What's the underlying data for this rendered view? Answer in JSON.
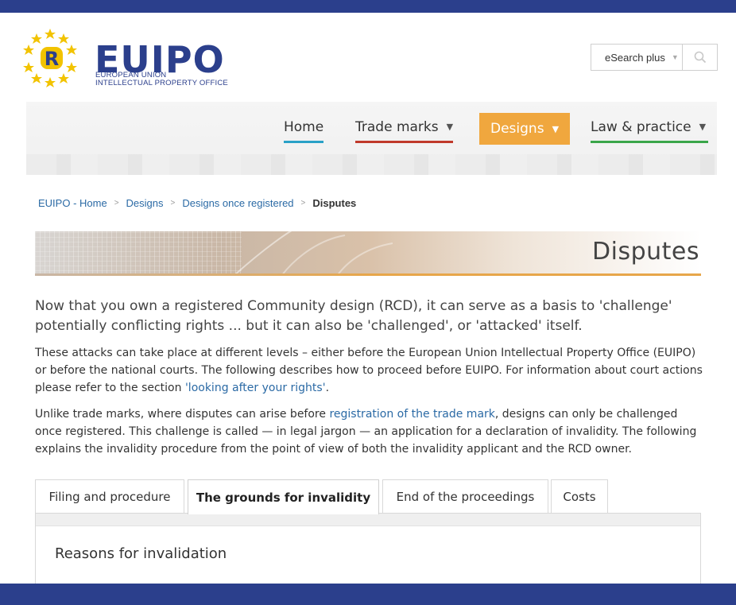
{
  "header": {
    "logo": {
      "wordmark_eu": "EU",
      "wordmark_ipo": "IPO",
      "line1": "EUROPEAN UNION",
      "line2": "INTELLECTUAL PROPERTY OFFICE"
    },
    "search": {
      "selected": "eSearch plus"
    }
  },
  "nav": {
    "items": [
      {
        "label": "Home",
        "accent": "#2aa1c7"
      },
      {
        "label": "Trade marks",
        "accent": "#c0392b"
      },
      {
        "label": "Designs",
        "accent": "#f0a73e",
        "active": true
      },
      {
        "label": "Law & practice",
        "accent": "#3aa64a"
      }
    ]
  },
  "breadcrumb": [
    "EUIPO - Home",
    "Designs",
    "Designs once registered",
    "Disputes"
  ],
  "page": {
    "title": "Disputes",
    "lead": "Now that you own a registered Community design (RCD), it can serve as a basis to 'challenge' potentially conflicting rights ... but it can also be 'challenged', or 'attacked' itself.",
    "p1_text": "These attacks can take place at different levels – either before the European Union Intellectual Property Office (EUIPO) or before the national courts. The following describes how to proceed before EUIPO. For information about court actions please refer to the section ",
    "p1_link": "'looking after your rights'",
    "p1_end": ".",
    "p2_start": "Unlike trade marks, where disputes can arise before ",
    "p2_link": "registration of the trade mark",
    "p2_end": ", designs can only be challenged once registered. This challenge is called — in legal jargon — an application for a declaration of invalidity. The following explains the invalidity procedure from the point of view of both the invalidity applicant and the RCD owner."
  },
  "tabs": [
    {
      "label": "Filing and procedure"
    },
    {
      "label": "The grounds for invalidity",
      "active": true
    },
    {
      "label": "End of the proceedings"
    },
    {
      "label": "Costs"
    }
  ],
  "tab_panel": {
    "heading": "Reasons for invalidation"
  },
  "colors": {
    "brand": "#2b3f8c",
    "link": "#2b6aa5",
    "designs": "#f0a73e"
  }
}
